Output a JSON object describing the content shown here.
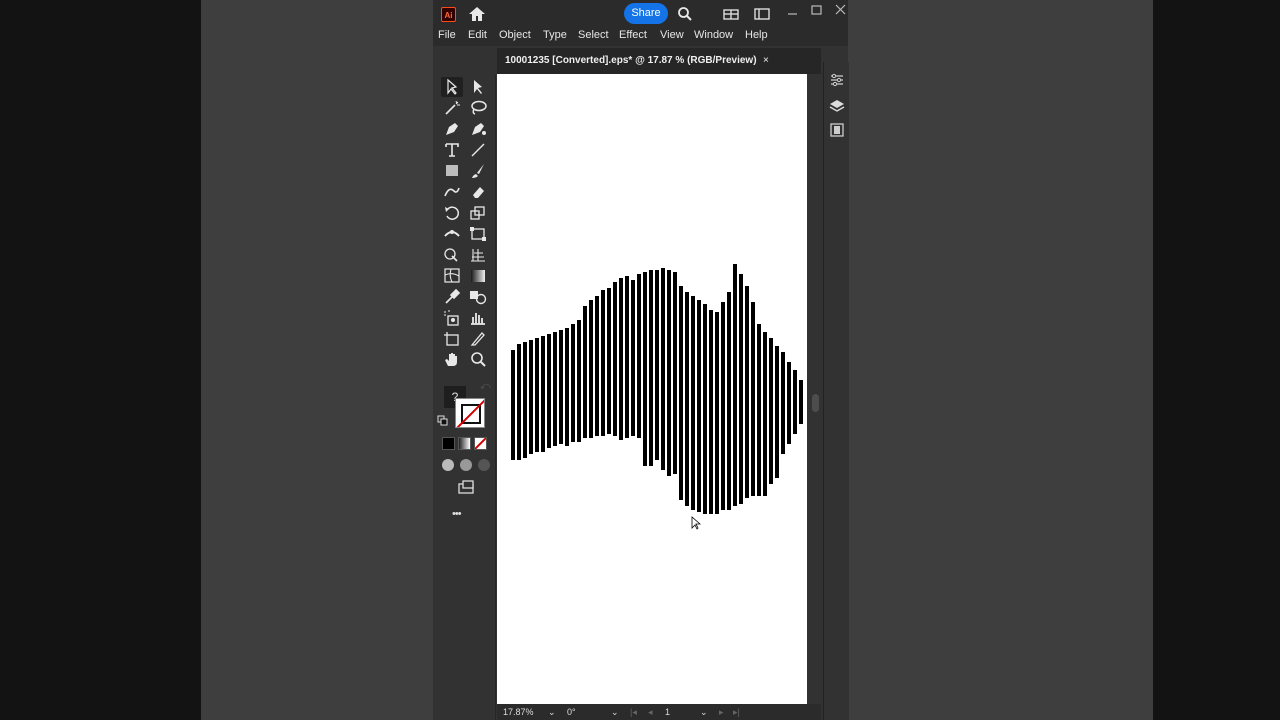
{
  "titlebar": {
    "share_label": "Share",
    "app_logo": "Ai"
  },
  "menu": [
    "File",
    "Edit",
    "Object",
    "Type",
    "Select",
    "Effect",
    "View",
    "Window",
    "Help"
  ],
  "document": {
    "tab_title": "10001235 [Converted].eps* @ 17.87 % (RGB/Preview)",
    "close": "×"
  },
  "status": {
    "zoom": "17.87%",
    "rotation": "0°",
    "artboard": "1"
  },
  "toolbar": {
    "unknown_swatch": "?",
    "more": "•••"
  },
  "colors": {
    "accent": "#1473e6",
    "panel": "#323232",
    "dark": "#262626",
    "canvas": "#ffffff"
  },
  "icons": [
    "home-icon",
    "search-icon",
    "arrange-documents-icon",
    "workspace-icon",
    "minimize-icon",
    "maximize-icon",
    "close-icon",
    "properties-icon",
    "layers-icon",
    "libraries-icon"
  ]
}
